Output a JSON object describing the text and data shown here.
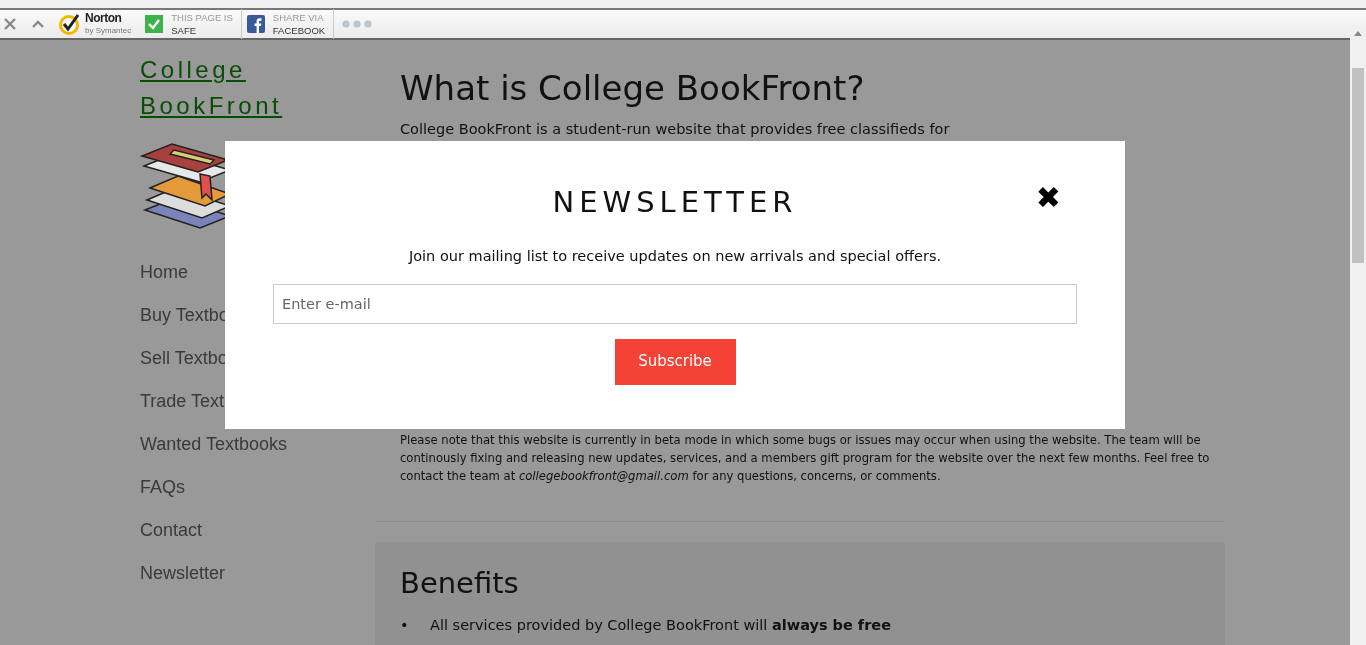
{
  "toolbar": {
    "norton": {
      "name": "Norton",
      "sub": "by Symantec"
    },
    "safety": {
      "line1": "THIS PAGE IS",
      "line2": "SAFE"
    },
    "share": {
      "line1": "SHARE VIA",
      "line2": "FACEBOOK"
    }
  },
  "site": {
    "title": "College BookFront"
  },
  "nav": [
    {
      "label": "Home"
    },
    {
      "label": "Buy Textbo"
    },
    {
      "label": "Sell Textbo"
    },
    {
      "label": "Trade Text"
    },
    {
      "label": "Wanted Textbooks"
    },
    {
      "label": "FAQs"
    },
    {
      "label": "Contact"
    },
    {
      "label": "Newsletter"
    }
  ],
  "main": {
    "heading": "What is College BookFront?",
    "intro": "College BookFront is a student-run website that provides free classifieds for",
    "note": "Please note that this website is currently in beta mode in which some bugs or issues may occur when using the website. The team will be continously fixing and releasing new updates, services, and a members gift program for the website over the next few months. Feel free to contact the team at *collegebookfront@gmail.com* for any questions, concerns, or comments.",
    "benefits": {
      "heading": "Benefits",
      "items": [
        {
          "bullet": "•",
          "text": "All services provided by College BookFront will **always be free**"
        }
      ]
    }
  },
  "modal": {
    "title": "NEWSLETTER",
    "close": "✖",
    "text": "Join our mailing list to receive updates on new arrivals and special offers.",
    "email_placeholder": "Enter e-mail",
    "button": "Subscribe"
  }
}
